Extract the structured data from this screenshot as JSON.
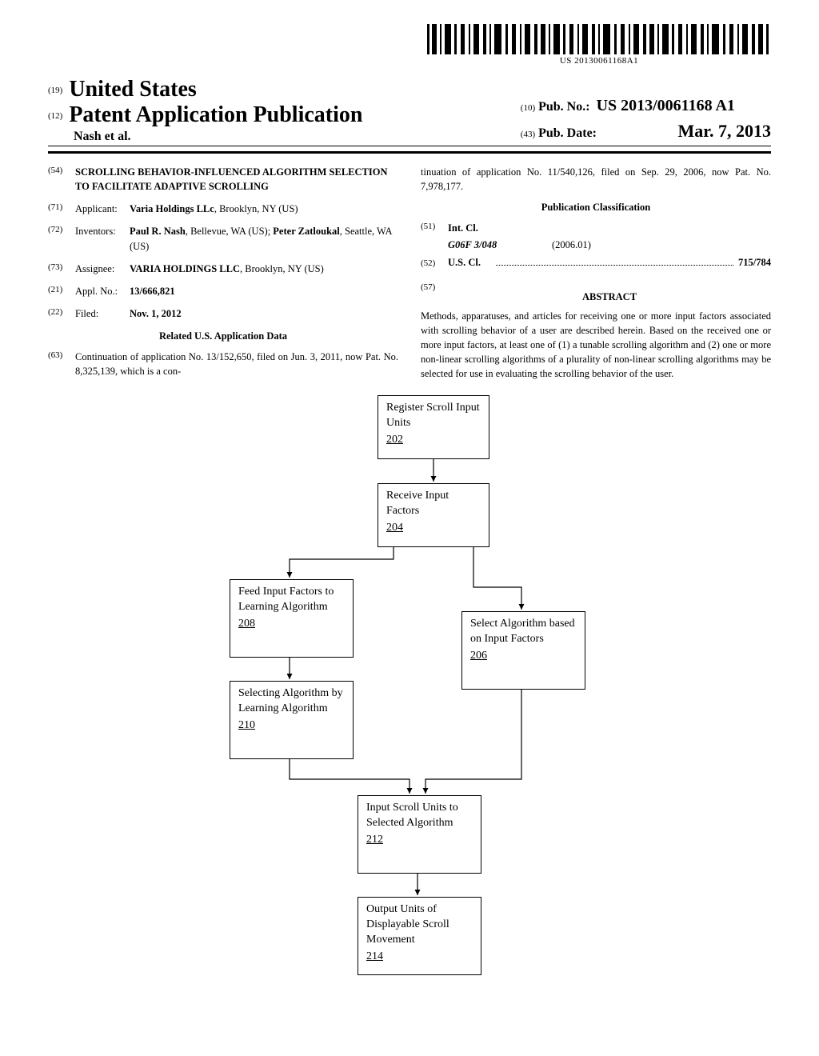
{
  "barcode_text": "US 20130061168A1",
  "header": {
    "inid_country": "(19)",
    "country": "United States",
    "inid_kind": "(12)",
    "kind": "Patent Application Publication",
    "authors": "Nash et al.",
    "inid_pubno": "(10)",
    "pubno_label": "Pub. No.:",
    "pubno": "US 2013/0061168 A1",
    "inid_pubdate": "(43)",
    "pubdate_label": "Pub. Date:",
    "pubdate": "Mar. 7, 2013"
  },
  "left_col": {
    "title_code": "(54)",
    "title": "SCROLLING BEHAVIOR-INFLUENCED ALGORITHM SELECTION TO FACILITATE ADAPTIVE SCROLLING",
    "applicant_code": "(71)",
    "applicant_label": "Applicant:",
    "applicant_value_html": "<b>Varia Holdings LLc</b>, Brooklyn, NY (US)",
    "inventors_code": "(72)",
    "inventors_label": "Inventors:",
    "inventors_value_html": "<b>Paul R. Nash</b>, Bellevue, WA (US); <b>Peter Zatloukal</b>, Seattle, WA (US)",
    "assignee_code": "(73)",
    "assignee_label": "Assignee:",
    "assignee_value_html": "<b>VARIA HOLDINGS LLC</b>, Brooklyn, NY (US)",
    "applno_code": "(21)",
    "applno_label": "Appl. No.:",
    "applno_value": "13/666,821",
    "filed_code": "(22)",
    "filed_label": "Filed:",
    "filed_value": "Nov. 1, 2012",
    "related_heading": "Related U.S. Application Data",
    "continuation_code": "(63)",
    "continuation_text": "Continuation of application No. 13/152,650, filed on Jun. 3, 2011, now Pat. No. 8,325,139, which is a con-"
  },
  "right_col": {
    "continuation_cont": "tinuation of application No. 11/540,126, filed on Sep. 29, 2006, now Pat. No. 7,978,177.",
    "classification_heading": "Publication Classification",
    "intcl_code": "(51)",
    "intcl_label": "Int. Cl.",
    "intcl_class": "G06F 3/048",
    "intcl_year": "(2006.01)",
    "uscl_code": "(52)",
    "uscl_label": "U.S. Cl.",
    "uscl_value": "715/784",
    "abstract_code": "(57)",
    "abstract_heading": "ABSTRACT",
    "abstract_text": "Methods, apparatuses, and articles for receiving one or more input factors associated with scrolling behavior of a user are described herein. Based on the received one or more input factors, at least one of (1) a tunable scrolling algorithm and (2) one or more non-linear scrolling algorithms of a plurality of non-linear scrolling algorithms may be selected for use in evaluating the scrolling behavior of the user."
  },
  "flowchart": {
    "b202": {
      "text": "Register Scroll Input Units",
      "ref": "202"
    },
    "b204": {
      "text": "Receive Input Factors",
      "ref": "204"
    },
    "b208": {
      "text": "Feed Input Factors to Learning Algorithm",
      "ref": "208"
    },
    "b206": {
      "text": "Select Algorithm based on Input Factors",
      "ref": "206"
    },
    "b210": {
      "text": "Selecting Algorithm by Learning Algorithm",
      "ref": "210"
    },
    "b212": {
      "text": "Input Scroll Units to Selected Algorithm",
      "ref": "212"
    },
    "b214": {
      "text": "Output Units of Displayable Scroll Movement",
      "ref": "214"
    }
  }
}
